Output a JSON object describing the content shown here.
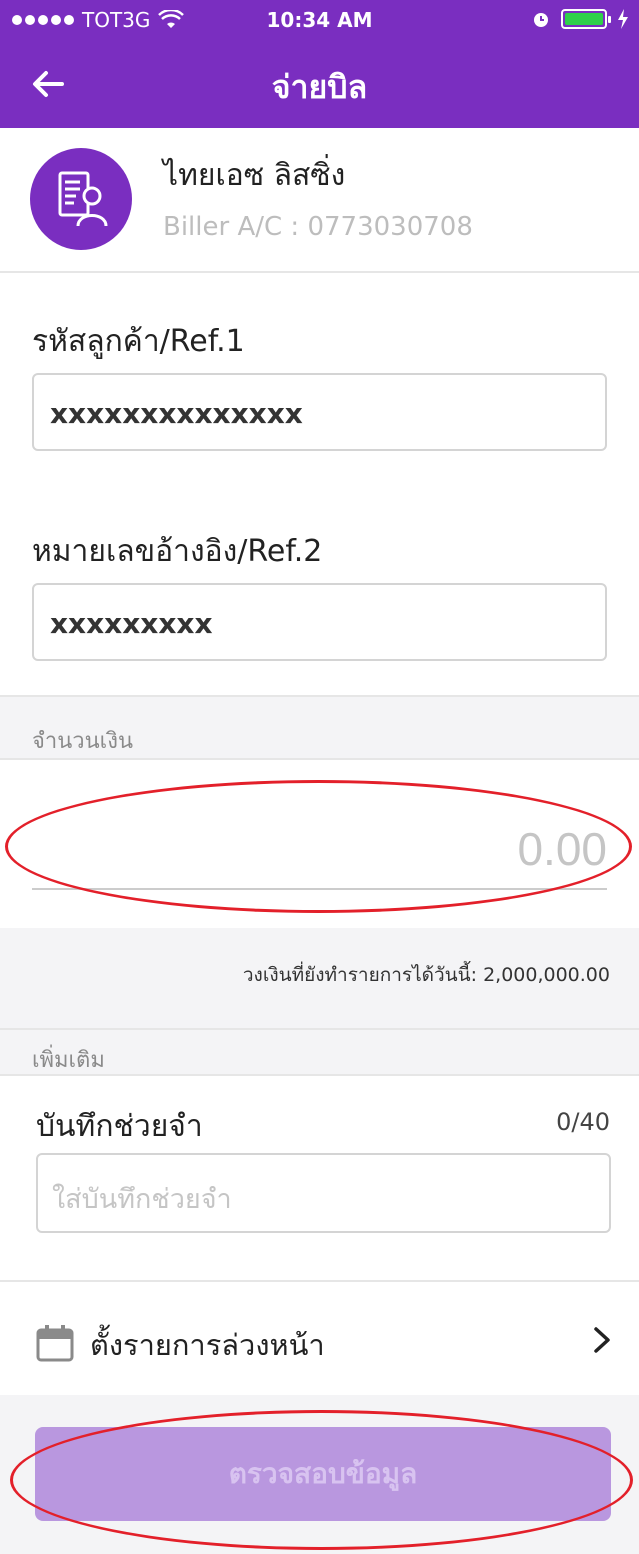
{
  "status_bar": {
    "carrier": "TOT3G",
    "time": "10:34 AM"
  },
  "header": {
    "title": "จ่ายบิล"
  },
  "biller": {
    "name": "ไทยเอซ ลิสซิ่ง",
    "account": "Biller A/C : 0773030708"
  },
  "form": {
    "ref1_label": "รหัสลูกค้า/Ref.1",
    "ref1_value": "xxxxxxxxxxxxxx",
    "ref2_label": "หมายเลขอ้างอิง/Ref.2",
    "ref2_value": "xxxxxxxxx"
  },
  "amount_section": {
    "title": "จำนวนเงิน",
    "placeholder": "0.00",
    "limit_text": "วงเงินที่ยังทำรายการได้วันนี้: 2,000,000.00"
  },
  "extra_section": {
    "title": "เพิ่มเติม",
    "memo_label": "บันทึกช่วยจำ",
    "memo_counter": "0/40",
    "memo_placeholder": "ใส่บันทึกช่วยจำ"
  },
  "schedule": {
    "label": "ตั้งรายการล่วงหน้า"
  },
  "footer": {
    "submit_label": "ตรวจสอบข้อมูล"
  },
  "colors": {
    "brand": "#7a2ec0",
    "button_disabled": "#b997df",
    "annotation": "#e3202a"
  }
}
